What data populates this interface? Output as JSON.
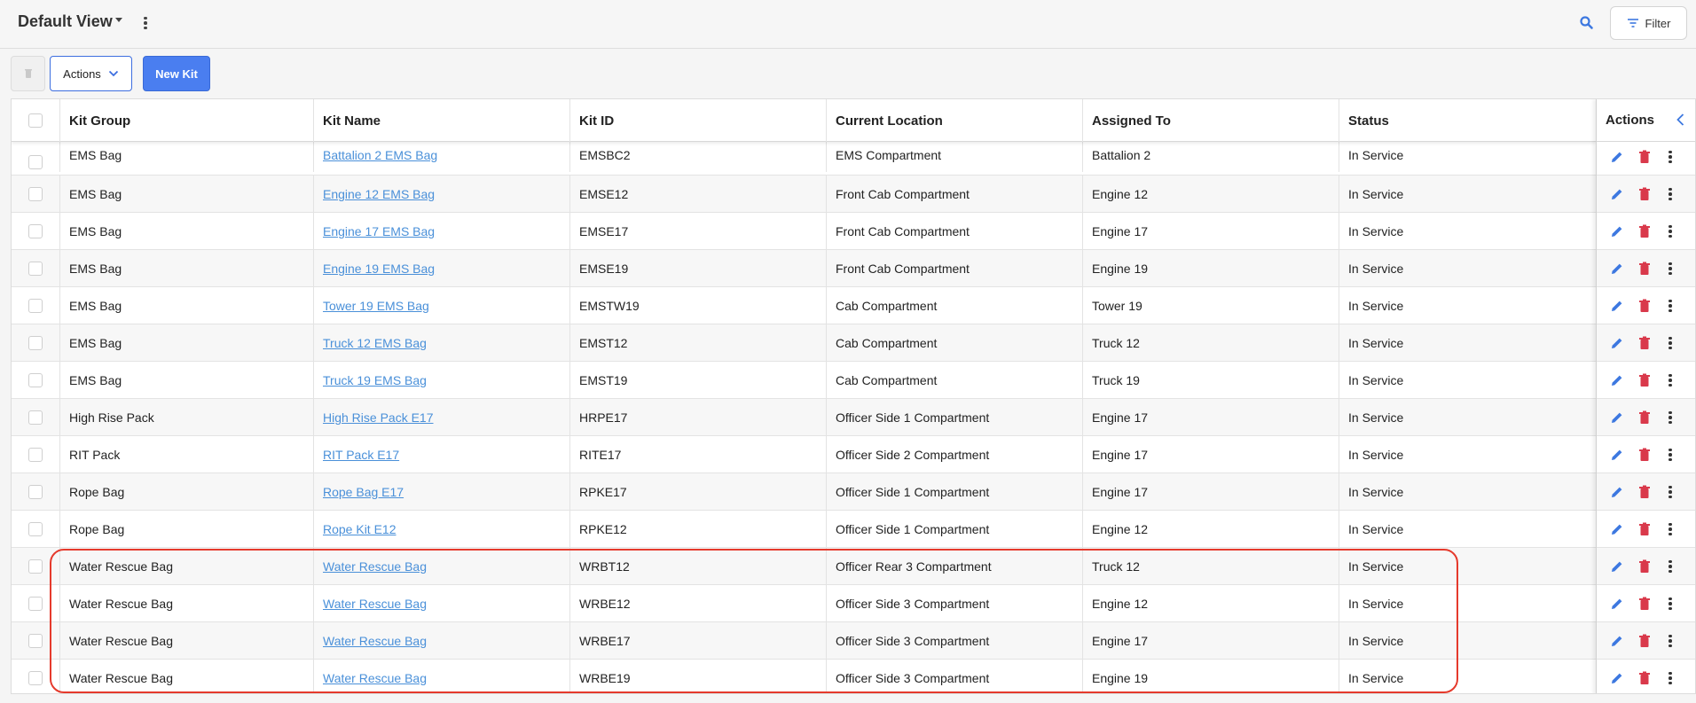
{
  "header": {
    "view_title": "Default View",
    "filter_label": "Filter"
  },
  "toolbar": {
    "actions_label": "Actions",
    "new_kit_label": "New Kit"
  },
  "table": {
    "columns": [
      "Kit Group",
      "Kit Name",
      "Kit ID",
      "Current Location",
      "Assigned To",
      "Status"
    ],
    "actions_header": "Actions",
    "rows": [
      {
        "group": "EMS Bag",
        "name": "Battalion 2 EMS Bag",
        "id": "EMSBC2",
        "location": "EMS Compartment",
        "assigned": "Battalion  2",
        "status": "In Service"
      },
      {
        "group": "EMS Bag",
        "name": "Engine 12 EMS Bag",
        "id": "EMSE12",
        "location": "Front Cab Compartment",
        "assigned": "Engine 12",
        "status": "In Service"
      },
      {
        "group": "EMS Bag",
        "name": "Engine 17 EMS Bag",
        "id": "EMSE17",
        "location": "Front Cab Compartment",
        "assigned": "Engine 17",
        "status": "In Service"
      },
      {
        "group": "EMS Bag",
        "name": "Engine 19 EMS Bag",
        "id": "EMSE19",
        "location": "Front Cab Compartment",
        "assigned": "Engine 19",
        "status": "In Service"
      },
      {
        "group": "EMS Bag",
        "name": "Tower 19 EMS Bag",
        "id": "EMSTW19",
        "location": "Cab Compartment",
        "assigned": "Tower 19",
        "status": "In Service"
      },
      {
        "group": "EMS Bag",
        "name": "Truck 12 EMS Bag",
        "id": "EMST12",
        "location": "Cab Compartment",
        "assigned": "Truck 12",
        "status": "In Service"
      },
      {
        "group": "EMS Bag",
        "name": "Truck 19 EMS Bag",
        "id": "EMST19",
        "location": "Cab Compartment",
        "assigned": "Truck 19",
        "status": "In Service"
      },
      {
        "group": "High Rise Pack",
        "name": "High Rise Pack E17",
        "id": "HRPE17",
        "location": "Officer Side 1 Compartment",
        "assigned": "Engine 17",
        "status": "In Service"
      },
      {
        "group": "RIT Pack",
        "name": "RIT Pack E17",
        "id": "RITE17",
        "location": "Officer Side 2 Compartment",
        "assigned": "Engine 17",
        "status": "In Service"
      },
      {
        "group": "Rope Bag",
        "name": "Rope Bag E17",
        "id": "RPKE17",
        "location": "Officer Side 1 Compartment",
        "assigned": "Engine 17",
        "status": "In Service"
      },
      {
        "group": "Rope Bag",
        "name": "Rope Kit E12",
        "id": "RPKE12",
        "location": "Officer Side 1 Compartment",
        "assigned": "Engine 12",
        "status": "In Service"
      },
      {
        "group": "Water Rescue Bag",
        "name": "Water Rescue Bag",
        "id": "WRBT12",
        "location": "Officer Rear 3 Compartment",
        "assigned": "Truck 12",
        "status": "In Service"
      },
      {
        "group": "Water Rescue Bag",
        "name": "Water Rescue Bag",
        "id": "WRBE12",
        "location": "Officer Side 3 Compartment",
        "assigned": "Engine 12",
        "status": "In Service"
      },
      {
        "group": "Water Rescue Bag",
        "name": "Water Rescue Bag",
        "id": "WRBE17",
        "location": "Officer Side 3 Compartment",
        "assigned": "Engine 17",
        "status": "In Service"
      },
      {
        "group": "Water Rescue Bag",
        "name": "Water Rescue Bag",
        "id": "WRBE19",
        "location": "Officer Side 3 Compartment",
        "assigned": "Engine 19",
        "status": "In Service"
      }
    ]
  },
  "colors": {
    "accent": "#4a7ef0",
    "link": "#4a90d9",
    "edit_icon": "#3d78e0",
    "delete_icon": "#d9394b",
    "highlight": "#e53a2c"
  },
  "icons": {
    "view_dropdown": "caret-down-icon",
    "view_menu": "kebab-icon",
    "search": "search-icon",
    "filter": "filter-lines-icon",
    "bulk_delete": "trash-icon",
    "actions_dropdown": "chevron-down-icon",
    "collapse": "chevron-left-icon",
    "row_edit": "pencil-icon",
    "row_delete": "trash-icon",
    "row_more": "kebab-icon"
  }
}
